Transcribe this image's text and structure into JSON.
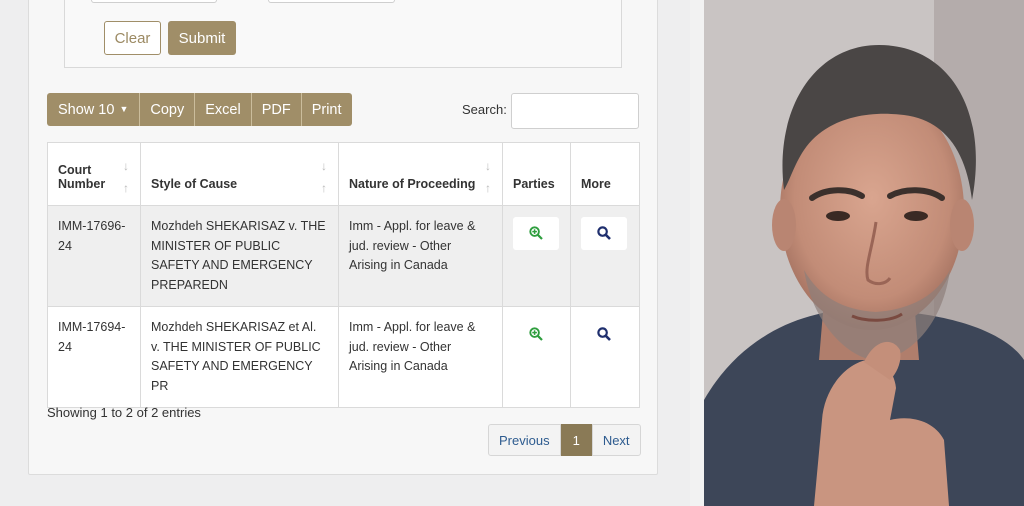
{
  "form": {
    "clear_label": "Clear",
    "submit_label": "Submit"
  },
  "toolbar": {
    "show_label": "Show 10",
    "copy_label": "Copy",
    "excel_label": "Excel",
    "pdf_label": "PDF",
    "print_label": "Print"
  },
  "search": {
    "label": "Search:",
    "value": ""
  },
  "table": {
    "headers": {
      "court_number": [
        "Court",
        "Number"
      ],
      "style_of_cause": "Style of Cause",
      "nature": "Nature of Proceeding",
      "parties": "Parties",
      "more": "More"
    },
    "rows": [
      {
        "court_number": "IMM-17696-24",
        "style_of_cause": "Mozhdeh SHEKARISAZ v. THE MINISTER OF PUBLIC SAFETY AND EMERGENCY PREPAREDN",
        "nature": "Imm - Appl. for leave & jud. review - Other Arising in Canada"
      },
      {
        "court_number": "IMM-17694-24",
        "style_of_cause": "Mozhdeh SHEKARISAZ et Al. v. THE MINISTER OF PUBLIC SAFETY AND EMERGENCY PR",
        "nature": "Imm - Appl. for leave & jud. review - Other Arising in Canada"
      }
    ]
  },
  "icons": {
    "parties": "zoom-in-icon",
    "more": "search-icon",
    "parties_color": "#2e9e3e",
    "more_color": "#1f2f6e"
  },
  "info": "Showing 1 to 2 of 2 entries",
  "pagination": {
    "previous_label": "Previous",
    "current_page": "1",
    "next_label": "Next"
  },
  "colors": {
    "accent": "#a08e68",
    "accent_active": "#8a7a56",
    "link": "#2d5b8f"
  }
}
